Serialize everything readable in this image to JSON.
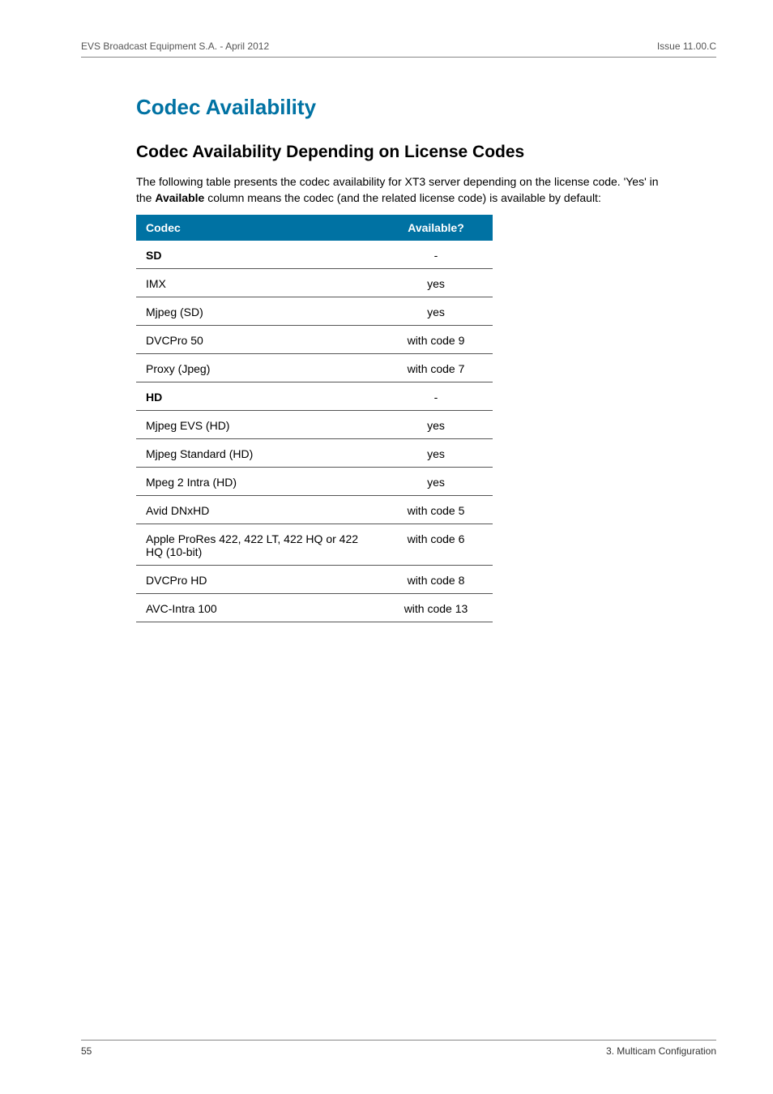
{
  "header": {
    "left": "EVS Broadcast Equipment S.A.  - April 2012",
    "right": "Issue 11.00.C"
  },
  "section": {
    "title": "Codec Availability",
    "subtitle": "Codec Availability Depending on License Codes",
    "intro_pre": "The following table presents the codec availability for XT3 server depending on the license code. 'Yes' in the ",
    "intro_bold": "Available",
    "intro_post": " column means the codec (and the related license code) is available by default:"
  },
  "table": {
    "head_codec": "Codec",
    "head_avail": "Available?",
    "rows": [
      {
        "name": "SD",
        "avail": "-",
        "group": true
      },
      {
        "name": "IMX",
        "avail": "yes",
        "group": false
      },
      {
        "name": "Mjpeg (SD)",
        "avail": "yes",
        "group": false
      },
      {
        "name": "DVCPro 50",
        "avail": "with code 9",
        "group": false
      },
      {
        "name": "Proxy (Jpeg)",
        "avail": "with code 7",
        "group": false
      },
      {
        "name": "HD",
        "avail": "-",
        "group": true
      },
      {
        "name": "Mjpeg EVS (HD)",
        "avail": "yes",
        "group": false
      },
      {
        "name": "Mjpeg Standard (HD)",
        "avail": "yes",
        "group": false
      },
      {
        "name": "Mpeg 2 Intra (HD)",
        "avail": "yes",
        "group": false
      },
      {
        "name": "Avid DNxHD",
        "avail": "with code 5",
        "group": false
      },
      {
        "name": "Apple ProRes 422, 422 LT, 422 HQ or 422 HQ (10-bit)",
        "avail": "with code 6",
        "group": false
      },
      {
        "name": "DVCPro HD",
        "avail": "with code 8",
        "group": false
      },
      {
        "name": "AVC-Intra 100",
        "avail": "with code 13",
        "group": false
      }
    ]
  },
  "footer": {
    "page_number": "55",
    "chapter": "3. Multicam Configuration"
  }
}
